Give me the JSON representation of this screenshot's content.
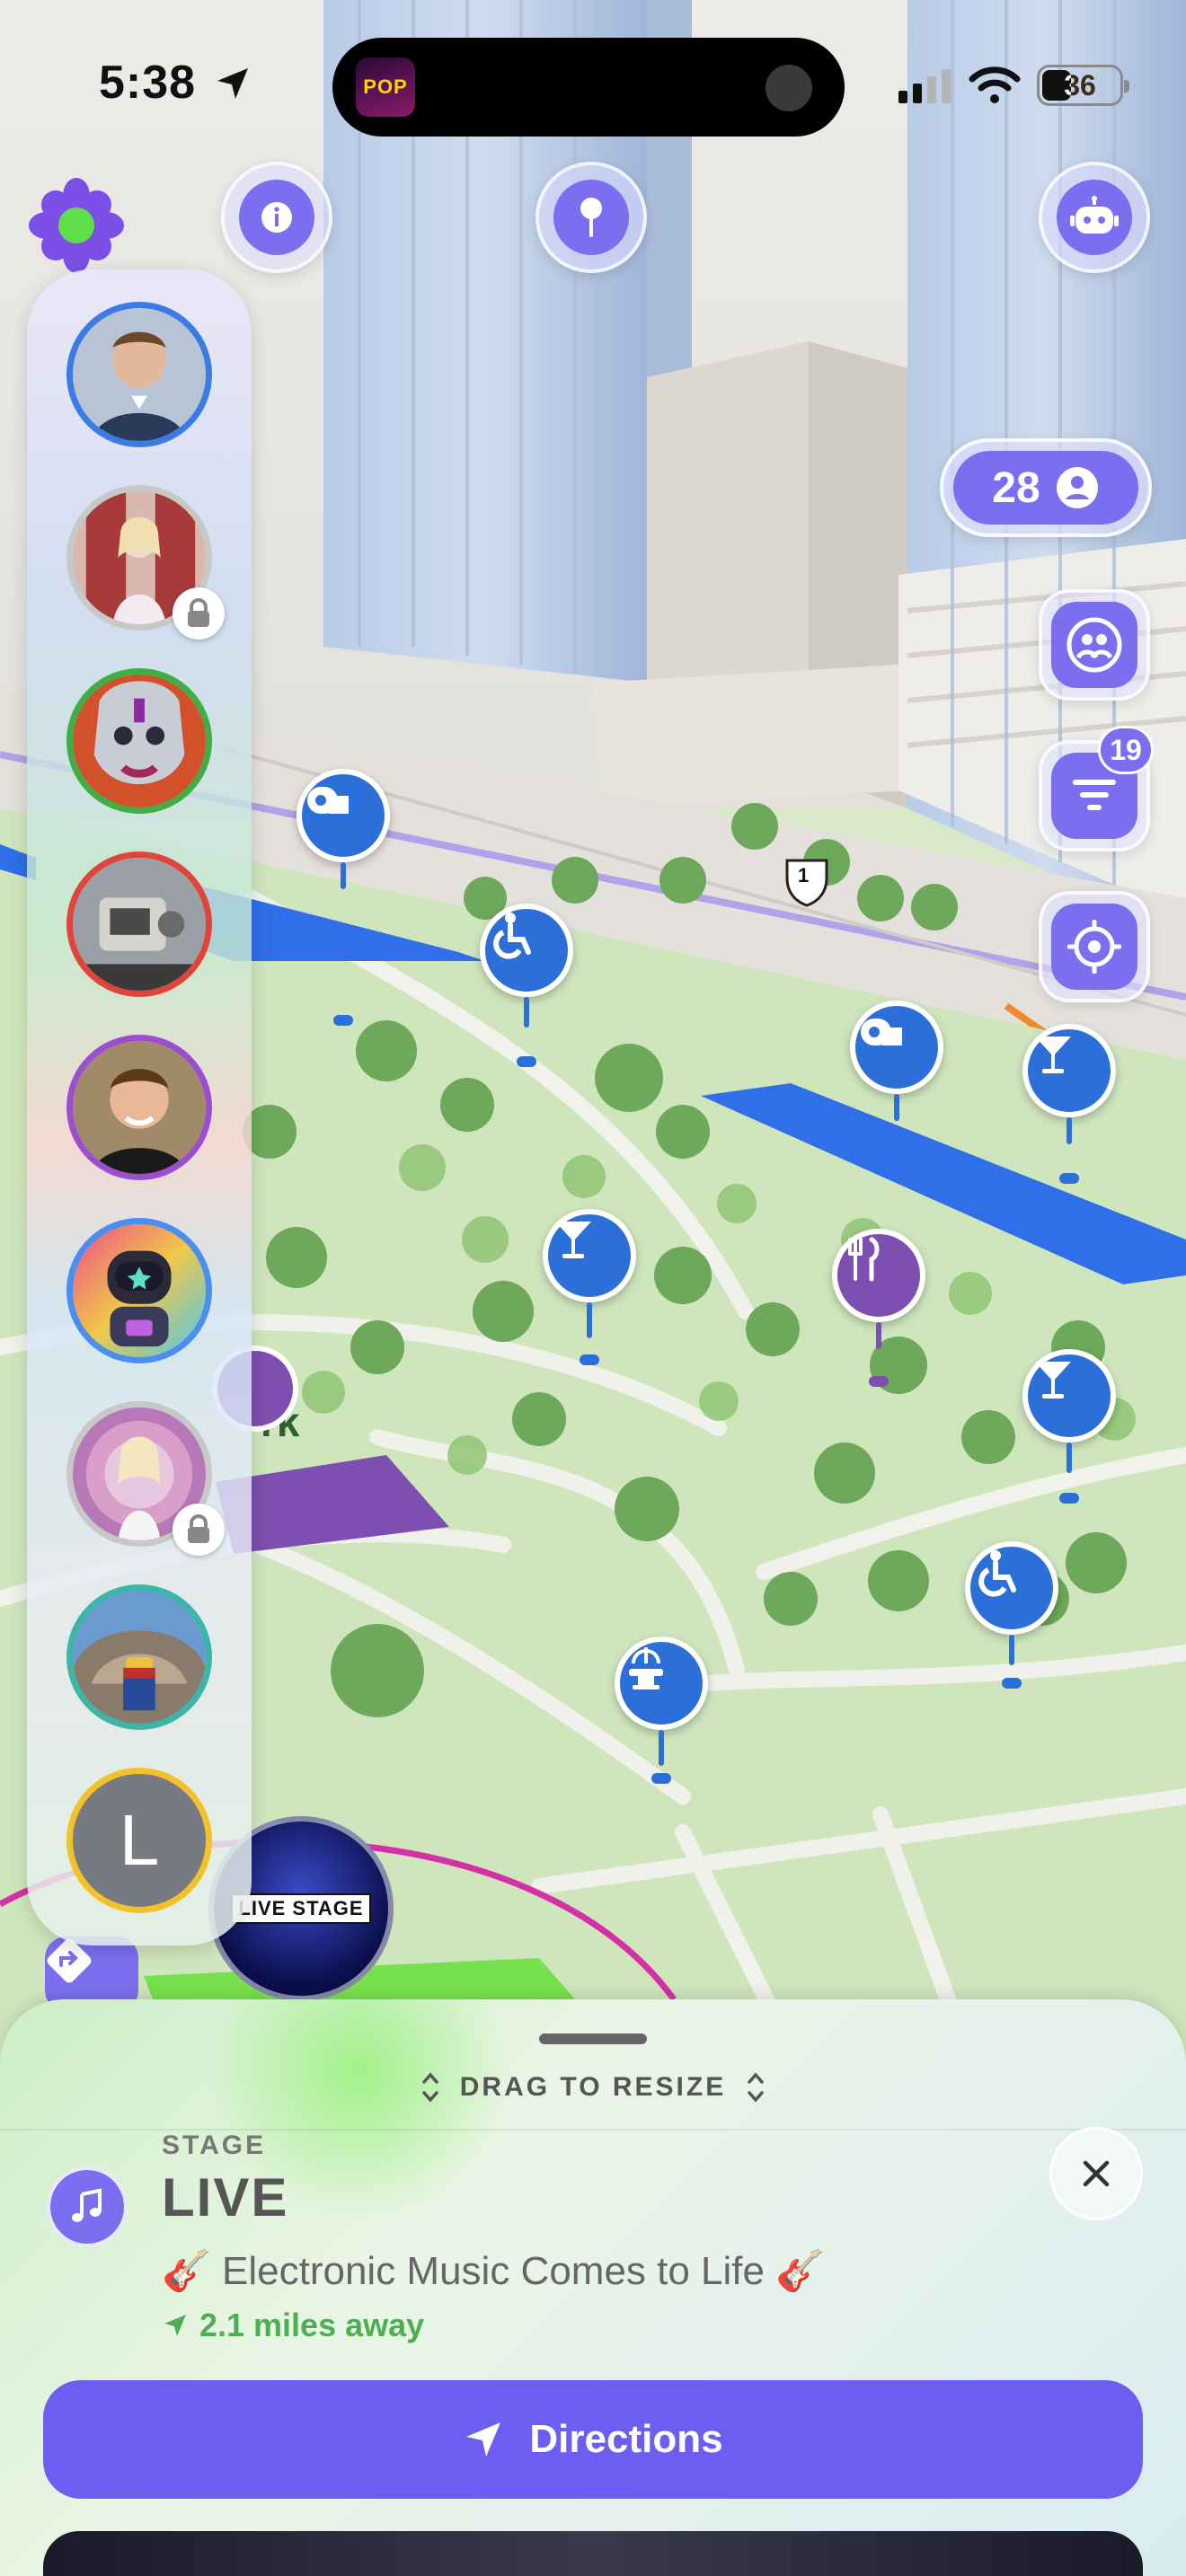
{
  "status_bar": {
    "time": "5:38",
    "battery": "36",
    "now_playing_art_text": "POP"
  },
  "map": {
    "label_fragment": "rk",
    "highway_shield": "1"
  },
  "top_controls": {
    "people_count": "28",
    "filter_badge": "19"
  },
  "avatars": [
    {
      "name": "avatar-1",
      "ring": "#3b7be6",
      "locked": false
    },
    {
      "name": "avatar-2",
      "ring": "#c8c8c8",
      "locked": true
    },
    {
      "name": "avatar-3",
      "ring": "#3fae45",
      "locked": false
    },
    {
      "name": "avatar-4",
      "ring": "#e0443a",
      "locked": false
    },
    {
      "name": "avatar-5",
      "ring": "#9b4fd0",
      "locked": false
    },
    {
      "name": "avatar-6",
      "ring": "#4a8ef0",
      "locked": false
    },
    {
      "name": "avatar-7",
      "ring": "#c8c8c8",
      "locked": true
    },
    {
      "name": "avatar-8",
      "ring": "#3cb6a8",
      "locked": false
    },
    {
      "name": "avatar-9",
      "ring": "#f2c22a",
      "letter": "L",
      "locked": false
    }
  ],
  "stage_bubble": {
    "label": "LIVE STAGE"
  },
  "sheet": {
    "drag_label": "DRAG TO RESIZE",
    "category": "STAGE",
    "title": "LIVE",
    "subtitle": "🎸 Electronic Music Comes to Life 🎸",
    "distance": "2.1 miles away",
    "directions_label": "Directions"
  },
  "colors": {
    "accent": "#7b6ff0",
    "directions": "#6b5ef0",
    "pin_blue": "#2c6fd9",
    "pin_purple": "#7d4fb0",
    "distance_green": "#4caf50"
  }
}
